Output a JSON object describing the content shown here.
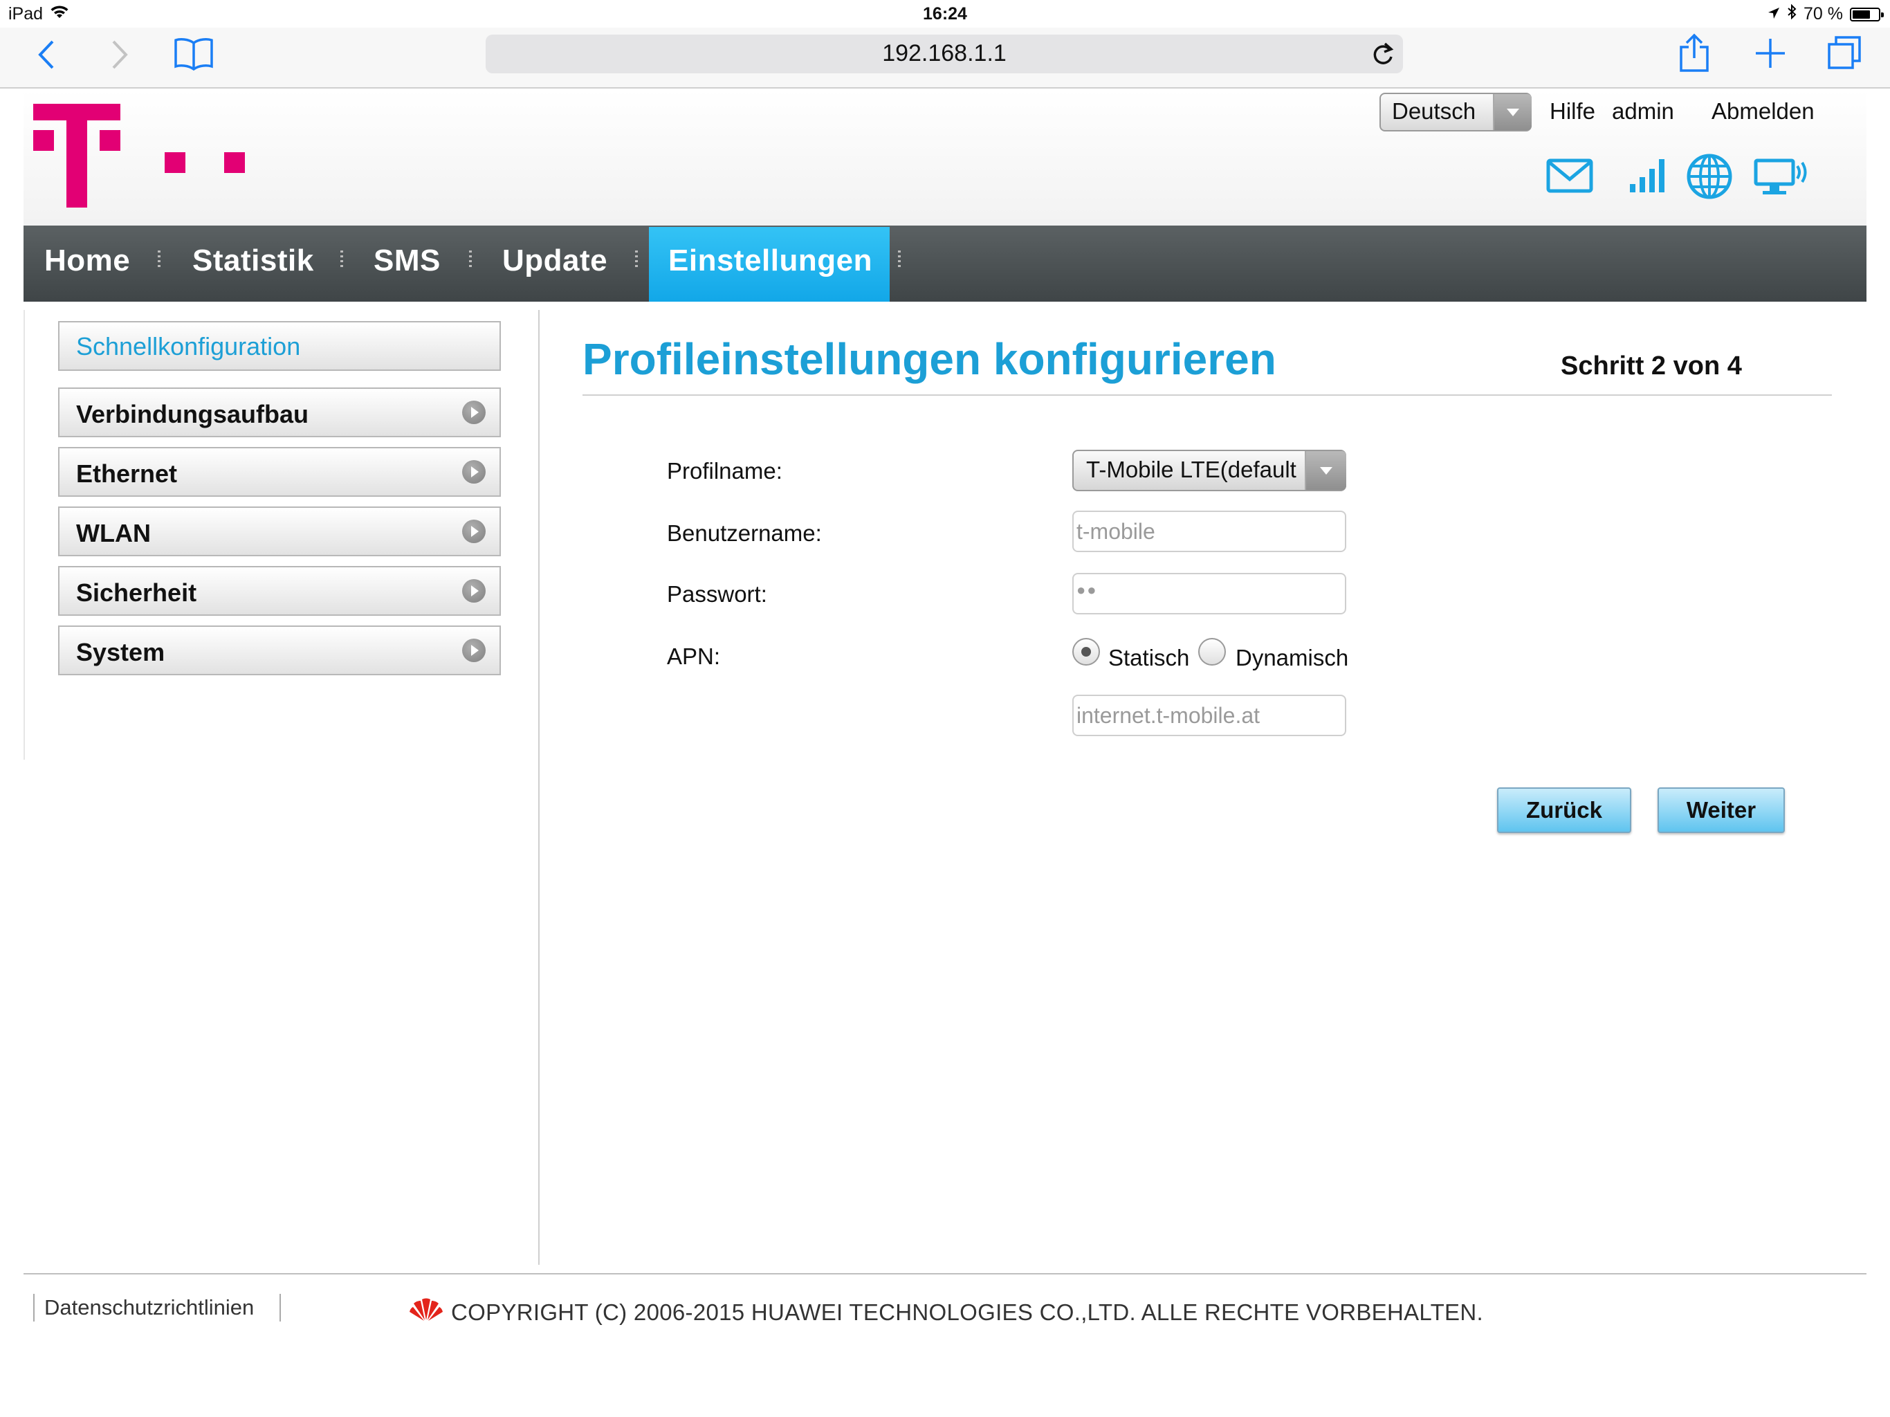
{
  "status_bar": {
    "device": "iPad",
    "time": "16:24",
    "battery": "70 %",
    "battery_level": 0.7
  },
  "browser": {
    "url": "192.168.1.1",
    "accent_color": "#1a7ef5"
  },
  "header": {
    "language": "Deutsch",
    "links": [
      "Hilfe",
      "admin",
      "Abmelden"
    ],
    "brand_color": "#e20074"
  },
  "nav": {
    "items": [
      "Home",
      "Statistik",
      "SMS",
      "Update",
      "Einstellungen"
    ],
    "active": "Einstellungen",
    "active_color": "#1faee9"
  },
  "sidebar": {
    "items": [
      {
        "label": "Schnellkonfiguration",
        "active": true
      },
      {
        "label": "Verbindungsaufbau"
      },
      {
        "label": "Ethernet"
      },
      {
        "label": "WLAN"
      },
      {
        "label": "Sicherheit"
      },
      {
        "label": "System"
      }
    ]
  },
  "main": {
    "title": "Profileinstellungen konfigurieren",
    "step": "Schritt 2 von 4",
    "form": {
      "profile_label": "Profilname:",
      "profile_value": "T-Mobile LTE(default)",
      "username_label": "Benutzername:",
      "username_value": "t-mobile",
      "password_label": "Passwort:",
      "password_value": "●●",
      "apn_label": "APN:",
      "apn_static": "Statisch",
      "apn_dynamic": "Dynamisch",
      "apn_selected": "Statisch",
      "apn_value": "internet.t-mobile.at"
    },
    "buttons": {
      "back": "Zurück",
      "next": "Weiter"
    }
  },
  "footer": {
    "privacy": "Datenschutzrichtlinien",
    "copyright": "COPYRIGHT (C) 2006-2015 HUAWEI TECHNOLOGIES CO.,LTD. ALLE RECHTE VORBEHALTEN."
  }
}
